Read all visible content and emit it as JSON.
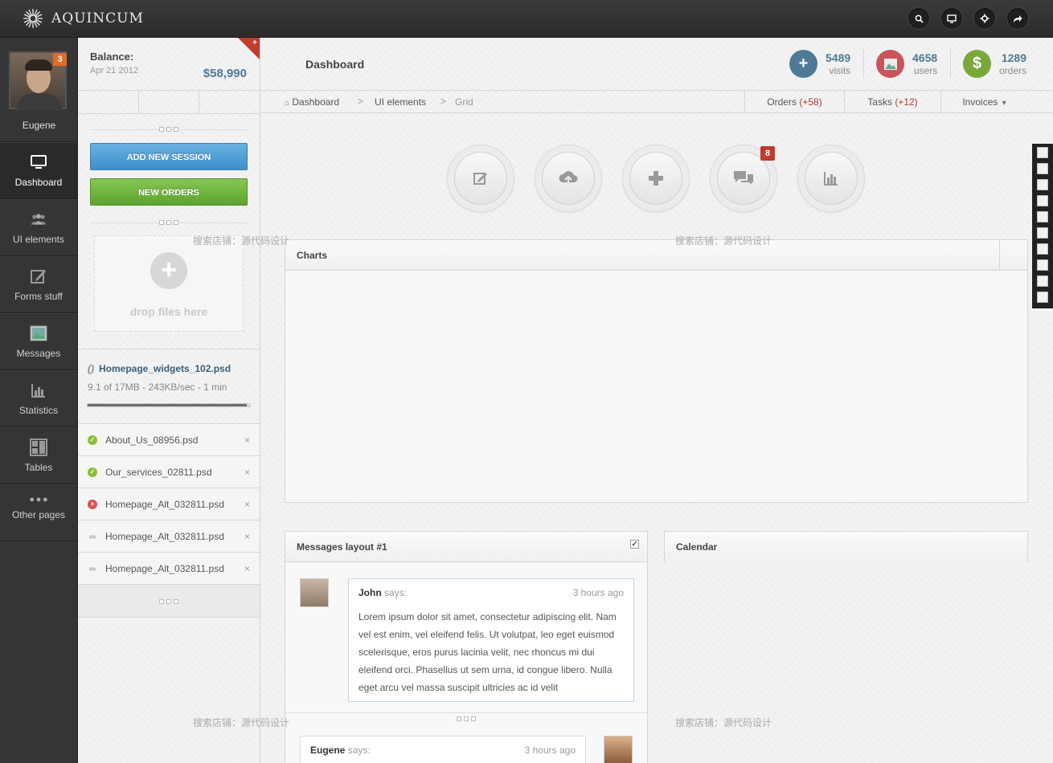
{
  "app": {
    "name": "AQUINCUM"
  },
  "topbar": {
    "icons": [
      "search-icon",
      "monitor-icon",
      "settings-icon",
      "logout-icon"
    ]
  },
  "user": {
    "name": "Eugene",
    "notifications": "3"
  },
  "nav": [
    {
      "label": "Dashboard",
      "icon": "monitor-icon",
      "active": true
    },
    {
      "label": "UI elements",
      "icon": "users-icon"
    },
    {
      "label": "Forms stuff",
      "icon": "edit-icon"
    },
    {
      "label": "Messages",
      "icon": "image-icon"
    },
    {
      "label": "Statistics",
      "icon": "bar-chart-icon"
    },
    {
      "label": "Tables",
      "icon": "grid-icon"
    },
    {
      "label": "Other pages",
      "icon": "dots-icon"
    }
  ],
  "balance": {
    "label": "Balance:",
    "date": "Apr 21 2012",
    "amount": "$58,990",
    "corner": "+"
  },
  "sidebar": {
    "add_session": "ADD NEW SESSION",
    "new_orders": "NEW ORDERS",
    "dropzone": "drop files here",
    "uploading": {
      "file": "Homepage_widgets_102.psd",
      "meta": "9.1 of 17MB - 243KB/sec - 1 min",
      "progress": 0.98
    },
    "files": [
      {
        "name": "About_Us_08956.psd",
        "status": "ok"
      },
      {
        "name": "Our_services_02811.psd",
        "status": "ok"
      },
      {
        "name": "Homepage_Alt_032811.psd",
        "status": "error"
      },
      {
        "name": "Homepage_Alt_032811.psd",
        "status": "pending"
      },
      {
        "name": "Homepage_Alt_032811.psd",
        "status": "pending"
      }
    ]
  },
  "header": {
    "title": "Dashboard",
    "stats": [
      {
        "value": "5489",
        "label": "visits",
        "icon": "plus-icon",
        "color": "#4f7a95"
      },
      {
        "value": "4658",
        "label": "users",
        "icon": "image-icon",
        "color": "#c9555a"
      },
      {
        "value": "1289",
        "label": "orders",
        "icon": "dollar-icon",
        "color": "#7aa83a"
      }
    ]
  },
  "breadcrumb": {
    "items": [
      "Dashboard",
      "UI elements",
      "Grid"
    ],
    "sep": ">"
  },
  "tabs": {
    "orders": {
      "label": "Orders",
      "count": "(+58)"
    },
    "tasks": {
      "label": "Tasks",
      "count": "(+12)"
    },
    "invoices": {
      "label": "Invoices"
    }
  },
  "actions": [
    {
      "icon": "edit-icon"
    },
    {
      "icon": "cloud-upload-icon"
    },
    {
      "icon": "plus-icon"
    },
    {
      "icon": "chat-icon",
      "badge": "8"
    },
    {
      "icon": "bar-chart-icon"
    }
  ],
  "widgets": {
    "charts": {
      "title": "Charts"
    },
    "messages": {
      "title": "Messages layout #1",
      "items": [
        {
          "author": "John",
          "says": "says:",
          "time": "3 hours ago",
          "text": "Lorem ipsum dolor sit amet, consectetur adipiscing elit. Nam vel est enim, vel eleifend felis. Ut volutpat, leo eget euismod scelerisque, eros purus lacinia velit, nec rhoncus mi dui eleifend orci. Phasellus ut sem urna, id congue libero. Nulla eget arcu vel massa suscipit ultricies ac id velit"
        },
        {
          "author": "Eugene",
          "says": "says:",
          "time": "3 hours ago"
        }
      ]
    },
    "calendar": {
      "title": "Calendar"
    }
  },
  "watermark": "搜索店铺：源代码设计"
}
